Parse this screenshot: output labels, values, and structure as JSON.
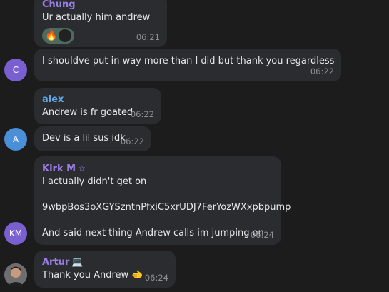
{
  "messages": [
    {
      "author": "Chung",
      "author_color": "#9b7ee3",
      "text": "Ur actually him andrew",
      "time": "06:21",
      "reactions": [
        "fire-emoji",
        "user-avatar"
      ]
    },
    {
      "avatar_initial": "C",
      "avatar_color": "#7a5fd0",
      "text": "I shouldve put in way more than I did but thank you regardless",
      "time": "06:22"
    },
    {
      "author": "alex",
      "author_color": "#5fa8e6",
      "text": "Andrew is fr goated",
      "time": "06:22"
    },
    {
      "avatar_initial": "A",
      "avatar_color": "#4b8fd9",
      "text": "Dev is a lil sus idk",
      "time": "06:22"
    },
    {
      "author": "Kirk M",
      "author_badge": "☆",
      "author_color": "#9b7ee3",
      "avatar_initial": "KM",
      "avatar_color": "#7a5fd0",
      "lines": [
        "I actually didn't get on",
        "9wbpBos3oXGYSzntnPfxiC5xrUDJ7FerYozWXxpbpump",
        "And said next thing Andrew calls im jumping on"
      ],
      "time": "06:24"
    },
    {
      "author": "Artur",
      "author_badge": "💻",
      "author_color": "#9b7ee3",
      "text": "Thank you Andrew 🫲",
      "time": "06:24"
    }
  ]
}
